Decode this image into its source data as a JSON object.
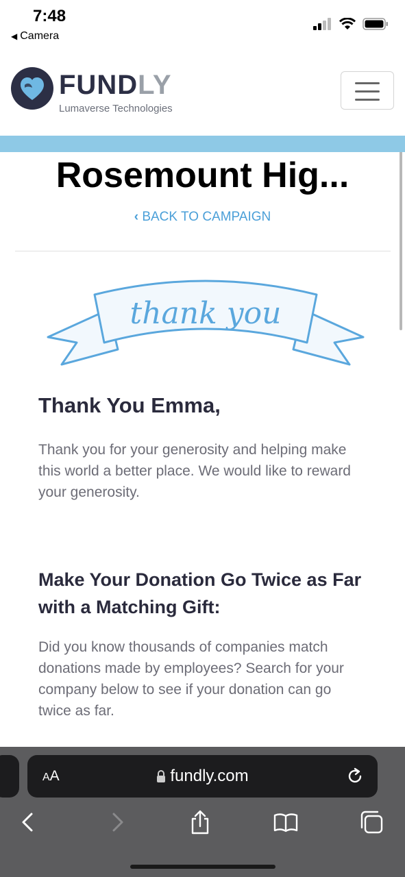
{
  "status_bar": {
    "time": "7:48",
    "back_app": "Camera"
  },
  "header": {
    "brand_main": "FUND",
    "brand_accent": "LY",
    "brand_sub": "Lumaverse Technologies"
  },
  "campaign": {
    "title": "Rosemount Hig...",
    "back_link": "BACK TO CAMPAIGN"
  },
  "banner": {
    "text": "thank you"
  },
  "content": {
    "thank_heading": "Thank You Emma,",
    "thank_text": "Thank you for your generosity and helping make this world a better place. We would like to reward your generosity.",
    "match_heading": "Make Your Donation Go Twice as Far with a Matching Gift:",
    "match_text": "Did you know thousands of companies match donations made by employees? Search for your company below to see if your donation can go twice as far."
  },
  "browser": {
    "aa_label_big": "A",
    "aa_label_small": "A",
    "url": "fundly.com"
  },
  "colors": {
    "accent": "#4a9fd8",
    "band": "#8ec9e6",
    "brand_dark": "#2c2f45"
  },
  "icons": [
    "signal-icon",
    "wifi-icon",
    "battery-icon",
    "hamburger-menu-icon",
    "lock-icon",
    "reload-icon",
    "back-arrow-icon",
    "forward-arrow-icon",
    "share-icon",
    "bookmarks-icon",
    "tabs-icon"
  ]
}
